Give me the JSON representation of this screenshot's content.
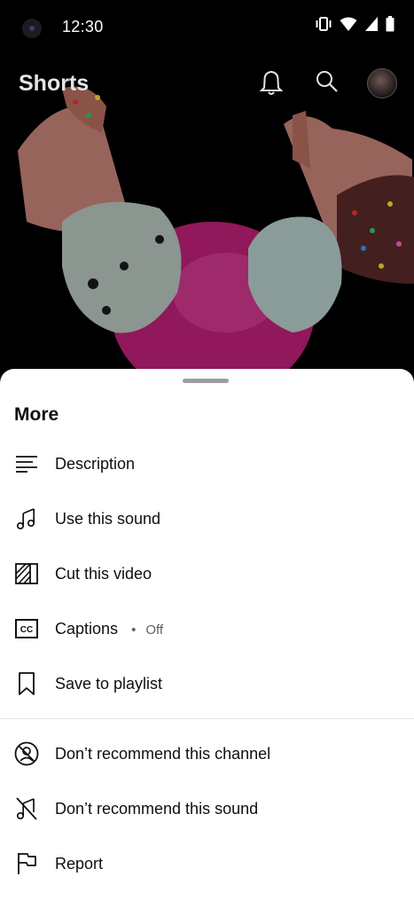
{
  "status_bar": {
    "time": "12:30"
  },
  "header": {
    "title": "Shorts"
  },
  "sheet": {
    "title": "More",
    "items_primary": [
      {
        "label": "Description",
        "icon": "description-icon"
      },
      {
        "label": "Use this sound",
        "icon": "music-note-icon"
      },
      {
        "label": "Cut this video",
        "icon": "cut-video-icon"
      },
      {
        "label": "Captions",
        "sub_separator": "•",
        "sub_value": "Off",
        "icon": "closed-captions-icon"
      },
      {
        "label": "Save to playlist",
        "icon": "bookmark-icon"
      }
    ],
    "items_secondary": [
      {
        "label": "Don’t recommend this channel",
        "icon": "block-channel-icon"
      },
      {
        "label": "Don’t recommend this sound",
        "icon": "block-sound-icon"
      },
      {
        "label": "Report",
        "icon": "flag-icon"
      }
    ]
  }
}
